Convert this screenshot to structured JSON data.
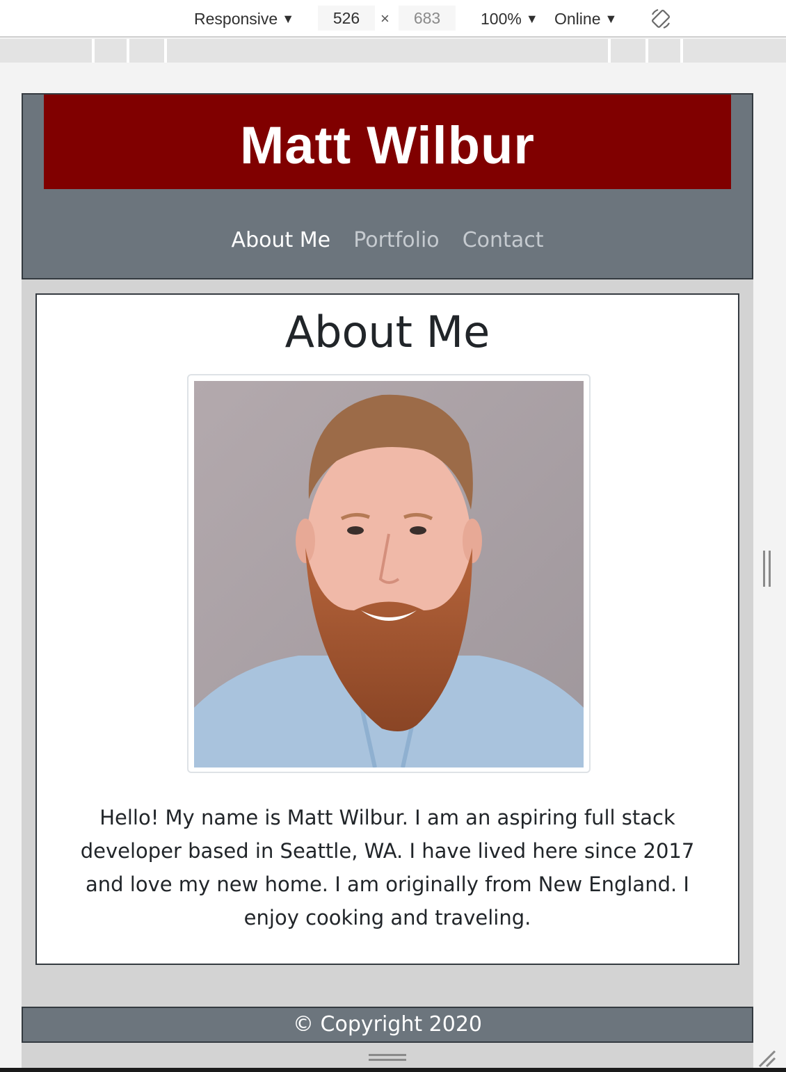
{
  "devtools": {
    "device_mode": "Responsive",
    "width": "526",
    "times": "×",
    "height": "683",
    "zoom": "100%",
    "network": "Online",
    "dropdown_arrow": "▼",
    "rotate_icon": "rotate-icon"
  },
  "site": {
    "title": "Matt Wilbur",
    "nav": [
      {
        "label": "About Me",
        "active": true
      },
      {
        "label": "Portfolio",
        "active": false
      },
      {
        "label": "Contact",
        "active": false
      }
    ],
    "about": {
      "heading": "About Me",
      "bio": "Hello! My name is Matt Wilbur. I am an aspiring full stack developer based in Seattle, WA. I have lived here since 2017 and love my new home. I am originally from New England. I enjoy cooking and traveling."
    },
    "footer": "© Copyright 2020"
  },
  "colors": {
    "banner": "#800000",
    "header_bg": "#6c757d",
    "page_bg": "#d3d3d3",
    "nav_active": "#ffffff",
    "nav_muted": "#c6cbd0"
  }
}
